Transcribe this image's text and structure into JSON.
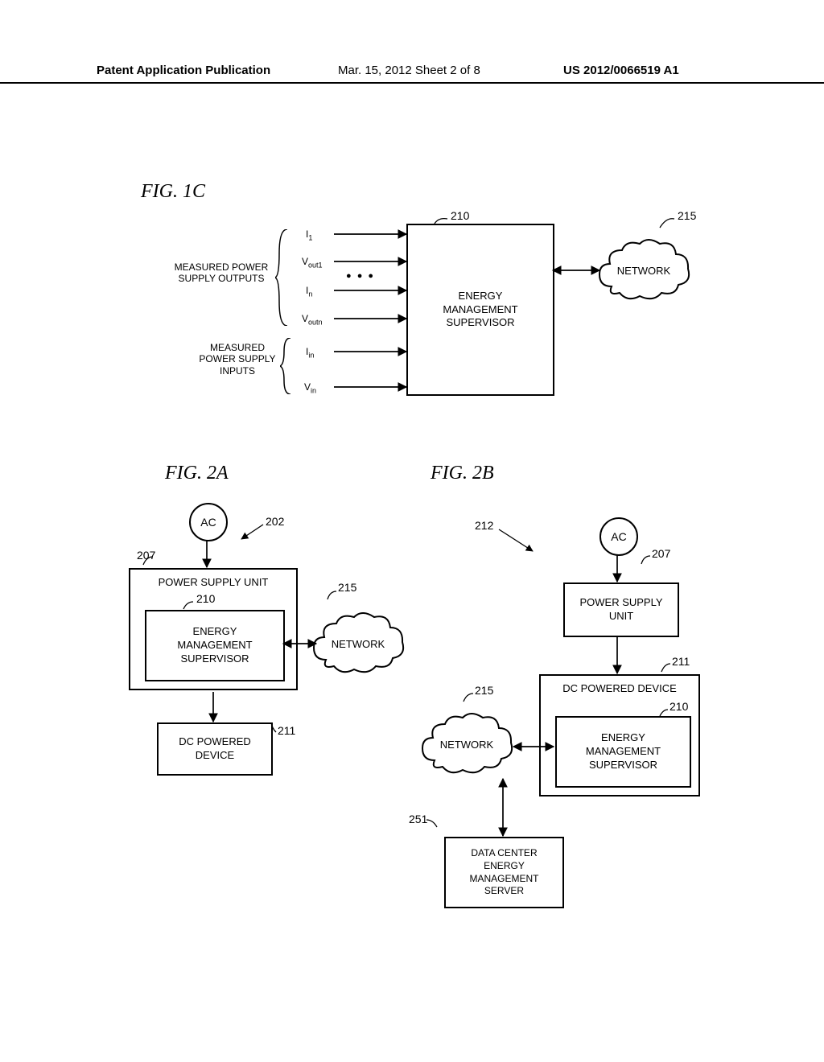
{
  "header": {
    "left": "Patent Application Publication",
    "mid": "Mar. 15, 2012  Sheet 2 of 8",
    "right": "US 2012/0066519 A1"
  },
  "fig1c": {
    "label": "FIG. 1C",
    "measured_outputs_label": "MEASURED POWER\nSUPPLY OUTPUTS",
    "measured_inputs_label": "MEASURED\nPOWER SUPPLY\nINPUTS",
    "ems_label": "ENERGY\nMANAGEMENT\nSUPERVISOR",
    "network_label": "NETWORK",
    "signals": {
      "i1": "I",
      "i1_sub": "1",
      "vout1": "V",
      "vout1_sub": "out1",
      "in_": "I",
      "in_sub": "n",
      "voutn": "V",
      "voutn_sub": "outn",
      "iin": "I",
      "iin_sub": "in",
      "vin": "V",
      "vin_sub": "in"
    },
    "dots": "● ● ●",
    "ref_210": "210",
    "ref_215": "215"
  },
  "fig2a": {
    "label": "FIG. 2A",
    "ac": "AC",
    "psu": "POWER SUPPLY UNIT",
    "ems": "ENERGY\nMANAGEMENT\nSUPERVISOR",
    "network": "NETWORK",
    "dc_device": "DC POWERED\nDEVICE",
    "ref_202": "202",
    "ref_207": "207",
    "ref_210": "210",
    "ref_211": "211",
    "ref_215": "215"
  },
  "fig2b": {
    "label": "FIG. 2B",
    "ac": "AC",
    "psu": "POWER SUPPLY\nUNIT",
    "ems": "ENERGY\nMANAGEMENT\nSUPERVISOR",
    "network": "NETWORK",
    "dc_device": "DC POWERED DEVICE",
    "server": "DATA CENTER\nENERGY\nMANAGEMENT\nSERVER",
    "ref_212": "212",
    "ref_207": "207",
    "ref_210": "210",
    "ref_211": "211",
    "ref_215": "215",
    "ref_251": "251"
  }
}
